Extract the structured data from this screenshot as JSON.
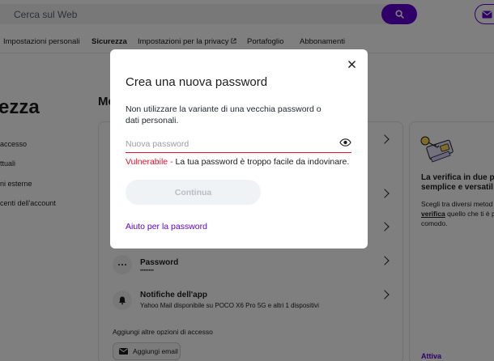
{
  "search": {
    "placeholder": "Cerca sul Web"
  },
  "nav_tabs": [
    {
      "label": "Impostazioni personali"
    },
    {
      "label": "Sicurezza"
    },
    {
      "label": "Impostazioni per la privacy"
    },
    {
      "label": "Portafoglio"
    },
    {
      "label": "Abbonamenti"
    }
  ],
  "page": {
    "title_fragment": "ezza",
    "section_fragment": "Me"
  },
  "sidebar": {
    "items": [
      {
        "label": "accesso"
      },
      {
        "label": "ttuali"
      },
      {
        "label": "ni esterne"
      },
      {
        "label": "centi dell'account"
      }
    ]
  },
  "security_card": {
    "password_row": {
      "title": "Password",
      "value": "••••••••"
    },
    "notifications_row": {
      "title": "Notifiche dell'app",
      "subtitle": "Yahoo Mail disponibile su POCO X6 Pro 5G e altri 1 dispositivi"
    },
    "add_options_heading": "Aggiungi altre opzioni di accesso",
    "add_email_label": "Aggiungi email"
  },
  "promo": {
    "title": "La verifica in due pa è semplice e versatil",
    "text_before": "Scegli tra diversi metod",
    "link_inline": "verifica",
    "text_after": "quello che ti è più comodo.",
    "cta": "Attiva"
  },
  "modal": {
    "title": "Crea una nuova password",
    "description": "Non utilizzare la variante di una vecchia password o dati personali.",
    "password_field": {
      "placeholder": "Nuova password",
      "value": ""
    },
    "strength_label": "Vulnerabile",
    "strength_separator": " - ",
    "strength_message": "La tua password è troppo facile da indovinare.",
    "continue_label": "Continua",
    "help_link": "Aiuto per la password"
  },
  "colors": {
    "brand": "#6001d2",
    "error": "#eb0f29",
    "overlay": "rgba(0,0,0,0.5)"
  }
}
